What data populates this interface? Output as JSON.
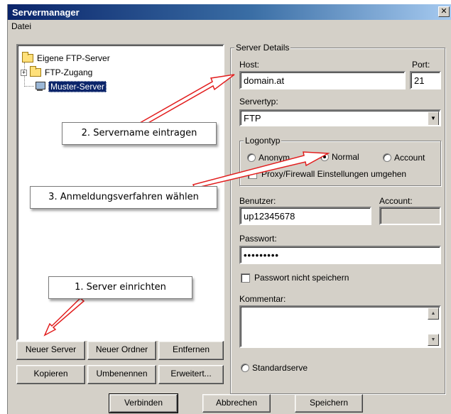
{
  "window": {
    "title": "Servermanager",
    "close_glyph": "✕"
  },
  "menu": {
    "file": "Datei"
  },
  "tree": {
    "root": "Eigene FTP-Server",
    "child_folder": "FTP-Zugang",
    "expander": "+",
    "server": "Muster-Server"
  },
  "left_buttons": {
    "new_server": "Neuer Server",
    "new_folder": "Neuer Ordner",
    "remove": "Entfernen",
    "copy": "Kopieren",
    "rename": "Umbenennen",
    "advanced": "Erweitert..."
  },
  "details": {
    "group_label": "Server Details",
    "host_label": "Host:",
    "host_value": "domain.at",
    "port_label": "Port:",
    "port_value": "21",
    "servertype_label": "Servertyp:",
    "servertype_value": "FTP",
    "logon": {
      "group_label": "Logontyp",
      "anonym": "Anonym",
      "normal": "Normal",
      "account": "Account",
      "proxy": "Proxy/Firewall Einstellungen umgehen"
    },
    "user_label": "Benutzer:",
    "user_value": "up12345678",
    "account_label": "Account:",
    "password_label": "Passwort:",
    "password_value": "•••••••••",
    "dont_save_password": "Passwort nicht speichern",
    "comment_label": "Kommentar:",
    "standard_server": "Standardserve"
  },
  "bottom_buttons": {
    "connect": "Verbinden",
    "cancel": "Abbrechen",
    "save": "Speichern"
  },
  "callouts": {
    "step1": "1.  Server einrichten",
    "step2": "2. Servername eintragen",
    "step3": "3. Anmeldungsverfahren wählen"
  },
  "colors": {
    "titlebar": "#0a246a",
    "window_face": "#d4d0c8",
    "arrow": "#e21d1d",
    "selection": "#0a246a"
  }
}
